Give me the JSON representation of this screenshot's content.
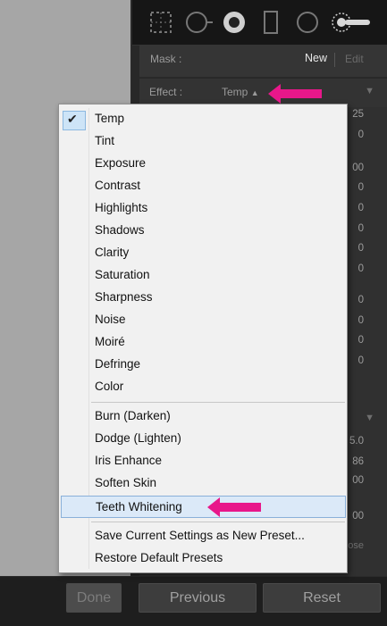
{
  "panel": {
    "mask_label": "Mask :",
    "mask_new": "New",
    "mask_edit": "Edit",
    "effect_label": "Effect :",
    "effect_value": "Temp",
    "effect_value_icon": "up-down-arrows-icon",
    "right_values": [
      "25",
      "0",
      "00",
      "0",
      "0",
      "0",
      "0",
      "0",
      "0",
      "0",
      "0",
      "0",
      "5.0",
      "86",
      "00",
      "00"
    ],
    "close_label": "ose"
  },
  "menu": {
    "selected": "Temp",
    "group1": [
      "Temp",
      "Tint",
      "Exposure",
      "Contrast",
      "Highlights",
      "Shadows",
      "Clarity",
      "Saturation",
      "Sharpness",
      "Noise",
      "Moiré",
      "Defringe",
      "Color"
    ],
    "group2": [
      "Burn (Darken)",
      "Dodge (Lighten)",
      "Iris Enhance",
      "Soften Skin",
      "Teeth Whitening"
    ],
    "group3": [
      "Save Current Settings as New Preset...",
      "Restore Default Presets"
    ],
    "highlighted": "Teeth Whitening"
  },
  "buttons": {
    "done": "Done",
    "previous": "Previous",
    "reset": "Reset"
  },
  "colors": {
    "annotation_arrow": "#e8178a",
    "highlight": "#dbe9f8"
  }
}
